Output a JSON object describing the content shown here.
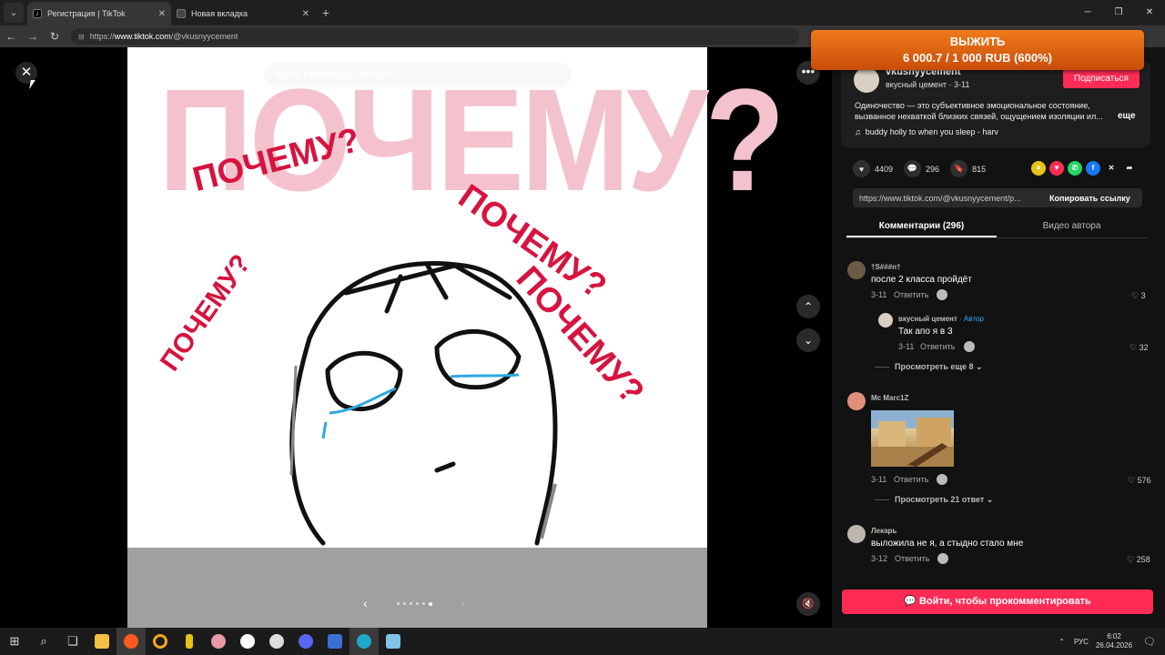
{
  "browser": {
    "tabs": [
      {
        "title": "Регистрация | TikTok",
        "favicon": "tiktok-icon"
      },
      {
        "title": "Новая вкладка",
        "favicon": "newtab-icon"
      }
    ],
    "url_prefix": "https://",
    "url_host": "www.tiktok.com",
    "url_path": "/@vkusnyycement"
  },
  "promo": {
    "line1": "ВЫЖИТЬ",
    "line2": "6 000.7 / 1 000 RUB (600%)"
  },
  "viewer": {
    "search_placeholder": "Найти связанный контент",
    "big_text": "ПОЧЕМУ?",
    "why_text": "ПОЧЕМУ?"
  },
  "author": {
    "handle": "vkusnyycement",
    "sub": "вкусный цемент · 3-11",
    "follow_label": "Подписаться",
    "description": "Одиночество — это субъективное эмоциональное состояние, вызванное нехваткой близких связей, ощущением изоляции ил...",
    "more_label": "еще",
    "music": "buddy holly to when you sleep - harv"
  },
  "stats": {
    "likes": "4409",
    "comments": "296",
    "saves": "815"
  },
  "link": {
    "url": "https://www.tiktok.com/@vkusnyycement/p...",
    "copy_label": "Копировать ссылку"
  },
  "tabs": {
    "comments": "Комментарии (296)",
    "author_videos": "Видео автора"
  },
  "comments": [
    {
      "name": "†S###n†",
      "text": "после 2 класса пройдёт",
      "date": "3-11",
      "reply": "Ответить",
      "likes": "3"
    },
    {
      "name": "вкусный цемент",
      "tag": " · Автор",
      "text": "Так апо я в 3",
      "date": "3-11",
      "reply": "Ответить",
      "likes": "32"
    },
    {
      "name": "Mc Marc1Z",
      "text": "",
      "date": "3-11",
      "reply": "Ответить",
      "likes": "576"
    },
    {
      "name": "Лекарь",
      "text": "выложила не я, а стыдно стало мне",
      "date": "3-12",
      "reply": "Ответить",
      "likes": "258"
    }
  ],
  "view_more": [
    "Просмотреть еще 8",
    "Просмотреть 21 ответ"
  ],
  "login_label": "Войти, чтобы прокомментировать",
  "taskbar": {
    "lang": "РУС",
    "time": "6:02",
    "date": "26.04.2026"
  },
  "colors": {
    "accent": "#fe2c55",
    "promo": "#e8650f",
    "why_red": "#d6143f",
    "big_pink": "#f4c2cc"
  }
}
